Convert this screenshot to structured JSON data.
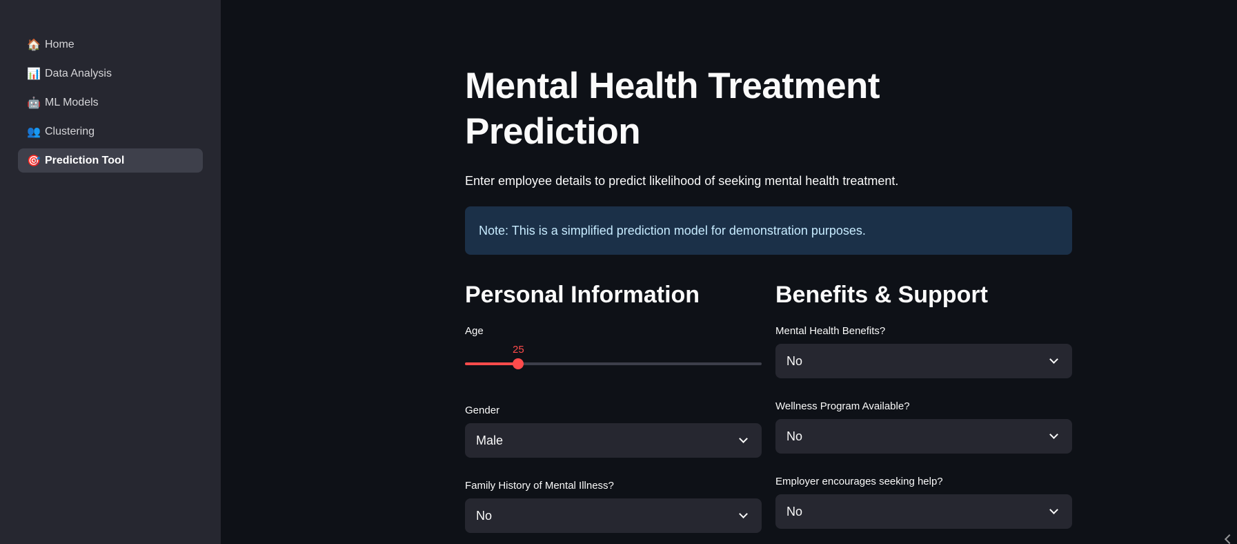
{
  "sidebar": {
    "items": [
      {
        "label": "Home",
        "icon": "🏠",
        "active": false
      },
      {
        "label": "Data Analysis",
        "icon": "📊",
        "active": false
      },
      {
        "label": "ML Models",
        "icon": "🤖",
        "active": false
      },
      {
        "label": "Clustering",
        "icon": "👥",
        "active": false
      },
      {
        "label": "Prediction Tool",
        "icon": "🎯",
        "active": true
      }
    ]
  },
  "main": {
    "title": "Mental Health Treatment Prediction",
    "subtitle": "Enter employee details to predict likelihood of seeking mental health treatment.",
    "info_note": "Note: This is a simplified prediction model for demonstration purposes.",
    "personal": {
      "heading": "Personal Information",
      "age_label": "Age",
      "age_value": "25",
      "age_fraction": 0.18,
      "gender_label": "Gender",
      "gender_value": "Male",
      "family_label": "Family History of Mental Illness?",
      "family_value": "No"
    },
    "benefits": {
      "heading": "Benefits & Support",
      "benefits_label": "Mental Health Benefits?",
      "benefits_value": "No",
      "wellness_label": "Wellness Program Available?",
      "wellness_value": "No",
      "help_label": "Employer encourages seeking help?",
      "help_value": "No"
    }
  },
  "colors": {
    "accent": "#ff4b4b",
    "sidebar_bg": "#262730",
    "main_bg": "#0e1117",
    "info_bg": "#1b3048",
    "info_text": "#c7ebff"
  }
}
